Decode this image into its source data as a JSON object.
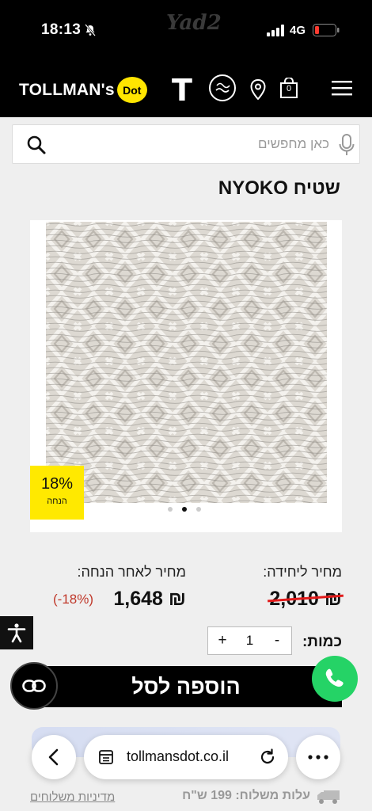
{
  "status_bar": {
    "time": "18:13",
    "watermark": "Yad2",
    "network": "4G"
  },
  "header": {
    "logo_text": "TOLLMAN's",
    "logo_badge": "Dot",
    "t_logo": "T",
    "badge_logo": "",
    "cart_count": "0"
  },
  "search": {
    "placeholder": "כאן מחפשים"
  },
  "product": {
    "title": "שטיח NYOKO",
    "discount_percent": "18%",
    "discount_label": "הנחה",
    "image_dots": 3,
    "image_active_index": 1
  },
  "pricing": {
    "unit_label": "מחיר ליחידה:",
    "unit_price": "₪ 2,010",
    "discount_label": "מחיר לאחר הנחה:",
    "discount_price": "₪ 1,648",
    "discount_note": "(-18%)"
  },
  "quantity": {
    "label": "כמות:",
    "minus": "-",
    "value": "1",
    "plus": "+"
  },
  "cart": {
    "add_label": "הוספה לסל"
  },
  "browser": {
    "url": "tollmansdot.co.il"
  },
  "footer": {
    "shipping_cost": "עלות משלוח: 199 ש\"ח",
    "shipping_policy": "מדיניות משלוחים"
  },
  "colors": {
    "brand_yellow": "#ffe500",
    "price_strike": "#e21a1a",
    "whatsapp": "#25d366"
  }
}
